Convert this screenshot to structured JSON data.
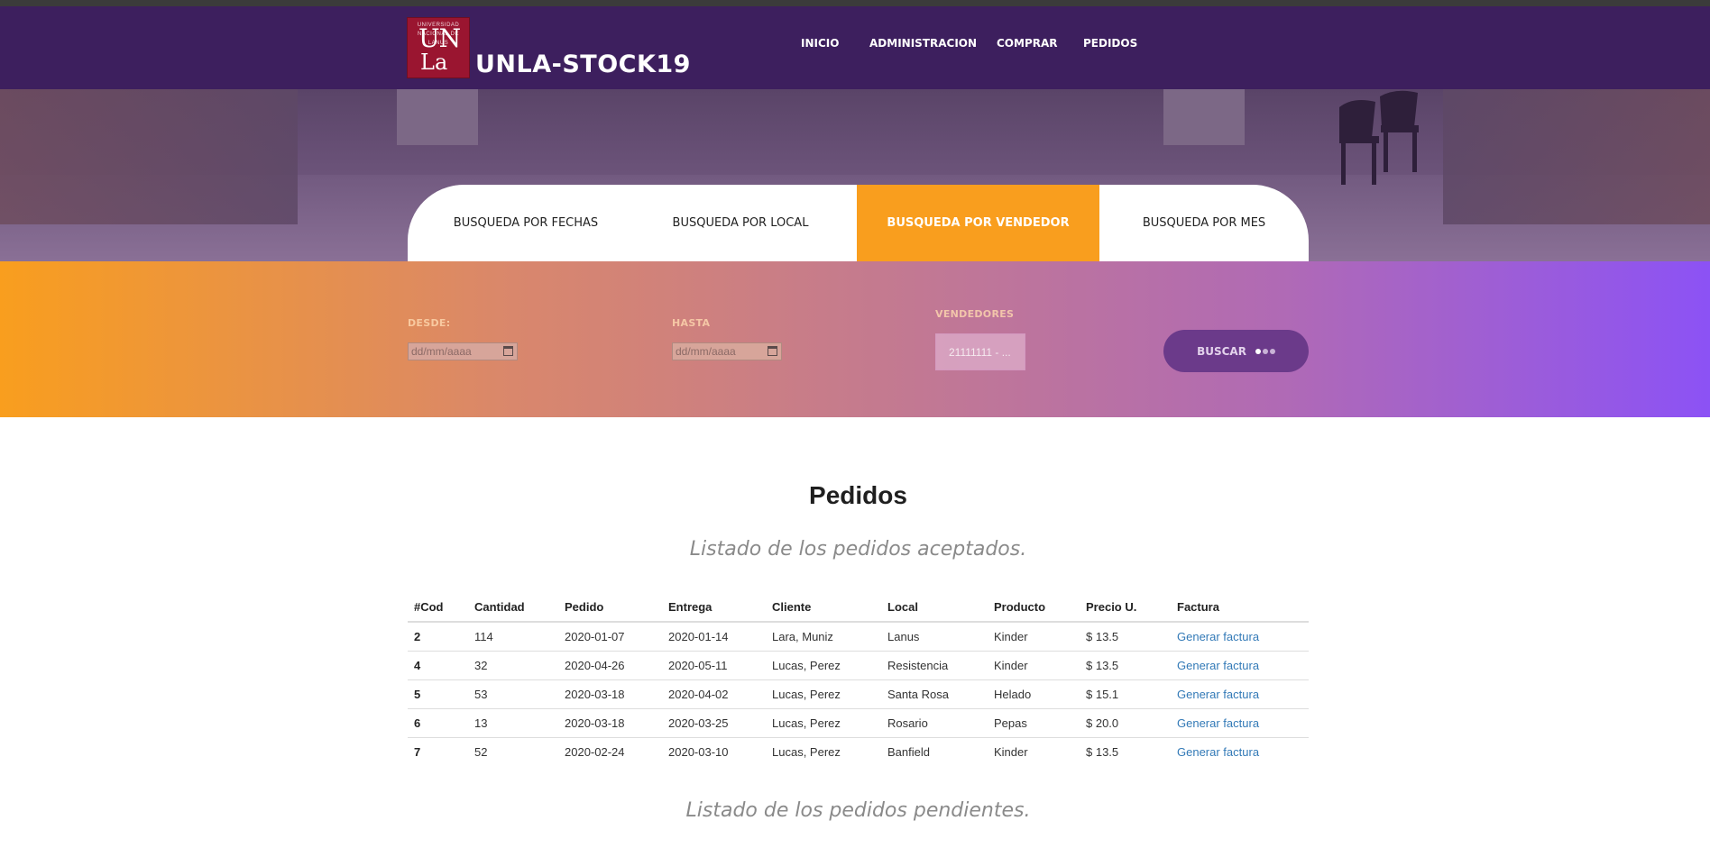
{
  "header": {
    "logo_text_top": "UNIVERSIDAD NACIONAL DE LANUS",
    "logo_un": "UN",
    "logo_la": "La",
    "brand": "UNLA-STOCK19",
    "nav": [
      {
        "label": "INICIO"
      },
      {
        "label": "ADMINISTRACION"
      },
      {
        "label": "COMPRAR"
      },
      {
        "label": "PEDIDOS"
      }
    ]
  },
  "tabs": [
    {
      "label": "BUSQUEDA POR FECHAS",
      "active": false
    },
    {
      "label": "BUSQUEDA POR LOCAL",
      "active": false
    },
    {
      "label": "BUSQUEDA POR VENDEDOR",
      "active": true
    },
    {
      "label": "BUSQUEDA POR MES",
      "active": false
    }
  ],
  "filters": {
    "desde_label": "DESDE:",
    "desde_value": "dd/mm/aaaa",
    "hasta_label": "HASTA",
    "hasta_value": "dd/mm/aaaa",
    "vendedores_label": "VENDEDORES",
    "vendedores_value": "21111111 - ...",
    "buscar_label": "BUSCAR"
  },
  "main": {
    "title": "Pedidos",
    "subtitle_accepted": "Listado de los pedidos aceptados.",
    "subtitle_pending": "Listado de los pedidos pendientes."
  },
  "table": {
    "columns": [
      "#Cod",
      "Cantidad",
      "Pedido",
      "Entrega",
      "Cliente",
      "Local",
      "Producto",
      "Precio U.",
      "Factura"
    ],
    "rows": [
      {
        "cod": "2",
        "cantidad": "114",
        "pedido": "2020-01-07",
        "entrega": "2020-01-14",
        "cliente": "Lara, Muniz",
        "local": "Lanus",
        "producto": "Kinder",
        "precio": "$ 13.5",
        "factura": "Generar factura"
      },
      {
        "cod": "4",
        "cantidad": "32",
        "pedido": "2020-04-26",
        "entrega": "2020-05-11",
        "cliente": "Lucas, Perez",
        "local": "Resistencia",
        "producto": "Kinder",
        "precio": "$ 13.5",
        "factura": "Generar factura"
      },
      {
        "cod": "5",
        "cantidad": "53",
        "pedido": "2020-03-18",
        "entrega": "2020-04-02",
        "cliente": "Lucas, Perez",
        "local": "Santa Rosa",
        "producto": "Helado",
        "precio": "$ 15.1",
        "factura": "Generar factura"
      },
      {
        "cod": "6",
        "cantidad": "13",
        "pedido": "2020-03-18",
        "entrega": "2020-03-25",
        "cliente": "Lucas, Perez",
        "local": "Rosario",
        "producto": "Pepas",
        "precio": "$ 20.0",
        "factura": "Generar factura"
      },
      {
        "cod": "7",
        "cantidad": "52",
        "pedido": "2020-02-24",
        "entrega": "2020-03-10",
        "cliente": "Lucas, Perez",
        "local": "Banfield",
        "producto": "Kinder",
        "precio": "$ 13.5",
        "factura": "Generar factura"
      }
    ]
  }
}
